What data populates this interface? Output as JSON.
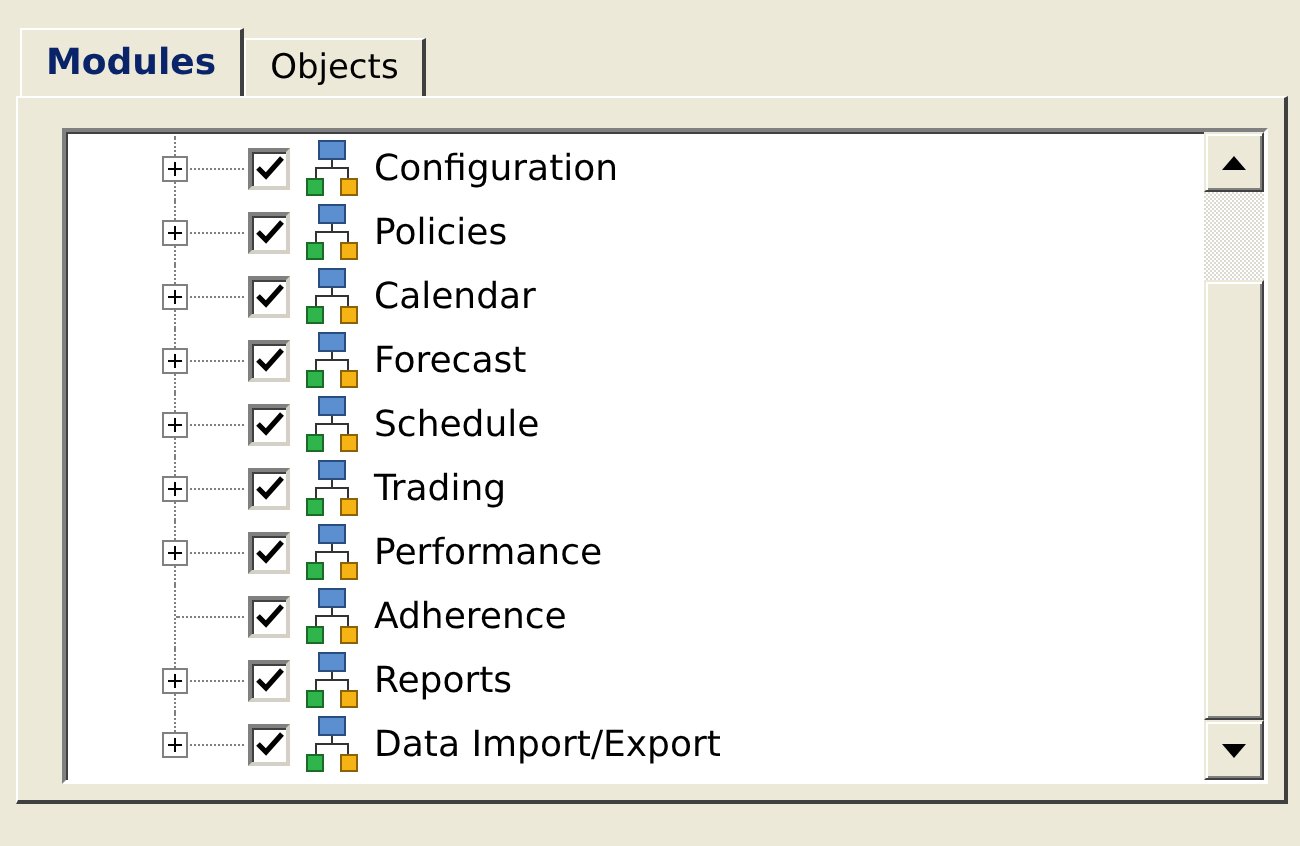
{
  "tabs": [
    {
      "label": "Modules",
      "selected": true
    },
    {
      "label": "Objects",
      "selected": false
    }
  ],
  "tree": {
    "items": [
      {
        "label": "Configuration",
        "checked": true,
        "has_children": true
      },
      {
        "label": "Policies",
        "checked": true,
        "has_children": true
      },
      {
        "label": "Calendar",
        "checked": true,
        "has_children": true
      },
      {
        "label": "Forecast",
        "checked": true,
        "has_children": true
      },
      {
        "label": "Schedule",
        "checked": true,
        "has_children": true
      },
      {
        "label": "Trading",
        "checked": true,
        "has_children": true
      },
      {
        "label": "Performance",
        "checked": true,
        "has_children": true
      },
      {
        "label": "Adherence",
        "checked": true,
        "has_children": false
      },
      {
        "label": "Reports",
        "checked": true,
        "has_children": true
      },
      {
        "label": "Data Import/Export",
        "checked": true,
        "has_children": true
      }
    ]
  }
}
